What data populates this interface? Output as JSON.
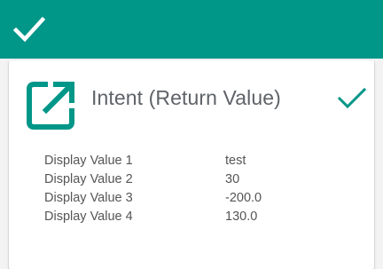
{
  "appbar": {
    "icon": "done-icon",
    "color": "#009688"
  },
  "card": {
    "icon": "open-in-new-icon",
    "title": "Intent (Return Value)",
    "status_icon": "check-icon",
    "accent": "#009688",
    "values": [
      {
        "label": "Display Value 1",
        "value": "test"
      },
      {
        "label": "Display Value 2",
        "value": "30"
      },
      {
        "label": "Display Value 3",
        "value": "-200.0"
      },
      {
        "label": "Display Value 4",
        "value": "130.0"
      }
    ]
  }
}
